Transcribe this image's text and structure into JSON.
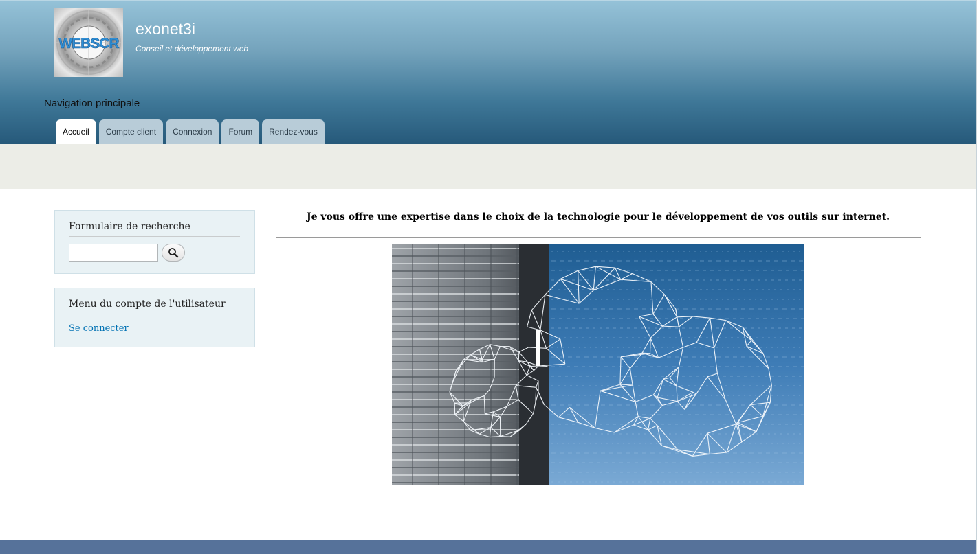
{
  "site": {
    "name": "exonet3i",
    "slogan": "Conseil et développement web",
    "logo_text": "WEBSCR"
  },
  "navigation": {
    "heading": "Navigation principale",
    "tabs": [
      {
        "label": "Accueil",
        "active": true
      },
      {
        "label": "Compte client",
        "active": false
      },
      {
        "label": "Connexion",
        "active": false
      },
      {
        "label": "Forum",
        "active": false
      },
      {
        "label": "Rendez-vous",
        "active": false
      }
    ]
  },
  "sidebar": {
    "search_block": {
      "title": "Formulaire de recherche",
      "input_value": "",
      "button_icon": "search-icon"
    },
    "user_block": {
      "title": "Menu du compte de l'utilisateur",
      "login_link": "Se connecter"
    }
  },
  "main": {
    "headline": "Je vous offre une expertise dans le choix de la technologie pour le développement de vos outils sur internet.",
    "hero_image": "server-rack-and-wireframe-cloud"
  },
  "colors": {
    "header_top": "#95c2d8",
    "header_bottom": "#26597a",
    "tab_inactive": "#b8ccd8",
    "band": "#ecede7",
    "sidebar_block": "#e9f2f5",
    "link": "#0071b3",
    "footer": "#56729a"
  }
}
